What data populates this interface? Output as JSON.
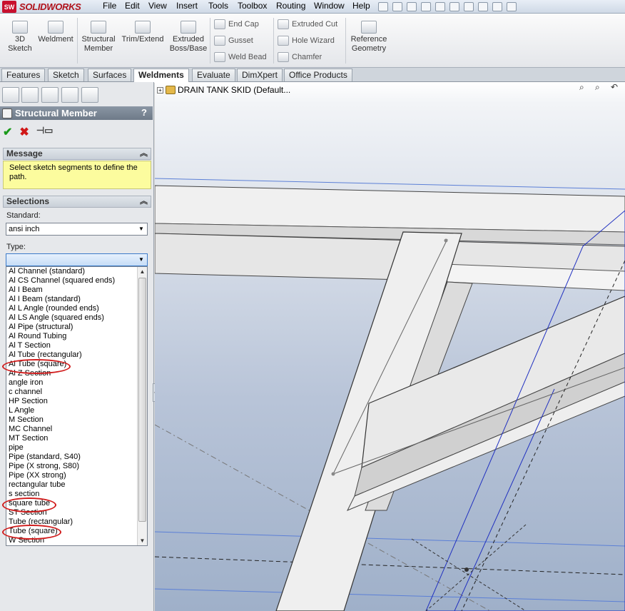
{
  "app": {
    "brand": "SOLIDWORKS",
    "logo_text": "SW"
  },
  "menu": [
    "File",
    "Edit",
    "View",
    "Insert",
    "Tools",
    "Toolbox",
    "Routing",
    "Window",
    "Help"
  ],
  "commands": {
    "sketch_3d": "3D\nSketch",
    "weldment": "Weldment",
    "structural_member": "Structural\nMember",
    "trim_extend": "Trim/Extend",
    "extruded_boss": "Extruded\nBoss/Base",
    "end_cap": "End Cap",
    "gusset": "Gusset",
    "weld_bead": "Weld Bead",
    "extruded_cut": "Extruded Cut",
    "hole_wizard": "Hole Wizard",
    "chamfer": "Chamfer",
    "reference_geometry": "Reference\nGeometry"
  },
  "tabs": [
    "Features",
    "Sketch",
    "Surfaces",
    "Weldments",
    "Evaluate",
    "DimXpert",
    "Office Products"
  ],
  "active_tab": "Weldments",
  "property_manager": {
    "title": "Structural Member",
    "help": "?",
    "message_header": "Message",
    "message": "Select sketch segments to define the path.",
    "selections_header": "Selections",
    "standard_label": "Standard:",
    "standard_value": "ansi inch",
    "type_label": "Type:",
    "type_value": "",
    "type_options": [
      "Al Channel (standard)",
      "Al CS Channel (squared ends)",
      "Al I Beam",
      "Al I Beam (standard)",
      "Al L Angle (rounded ends)",
      "Al LS Angle (squared ends)",
      "Al Pipe (structural)",
      "Al Round Tubing",
      "Al T Section",
      "Al Tube (rectangular)",
      "Al Tube (square)",
      "Al Z Section",
      "angle iron",
      "c channel",
      "HP Section",
      "L Angle",
      "M Section",
      "MC Channel",
      "MT Section",
      "pipe",
      "Pipe (standard, S40)",
      "Pipe (X strong, S80)",
      "Pipe (XX strong)",
      "rectangular tube",
      "s section",
      "square tube",
      "ST Section",
      "Tube (rectangular)",
      "Tube (square)",
      "W Section"
    ]
  },
  "tree": {
    "root": "DRAIN TANK SKID  (Default..."
  },
  "colors": {
    "annotation_circle": "#d11c1c",
    "message_bg": "#fcfc9e"
  }
}
